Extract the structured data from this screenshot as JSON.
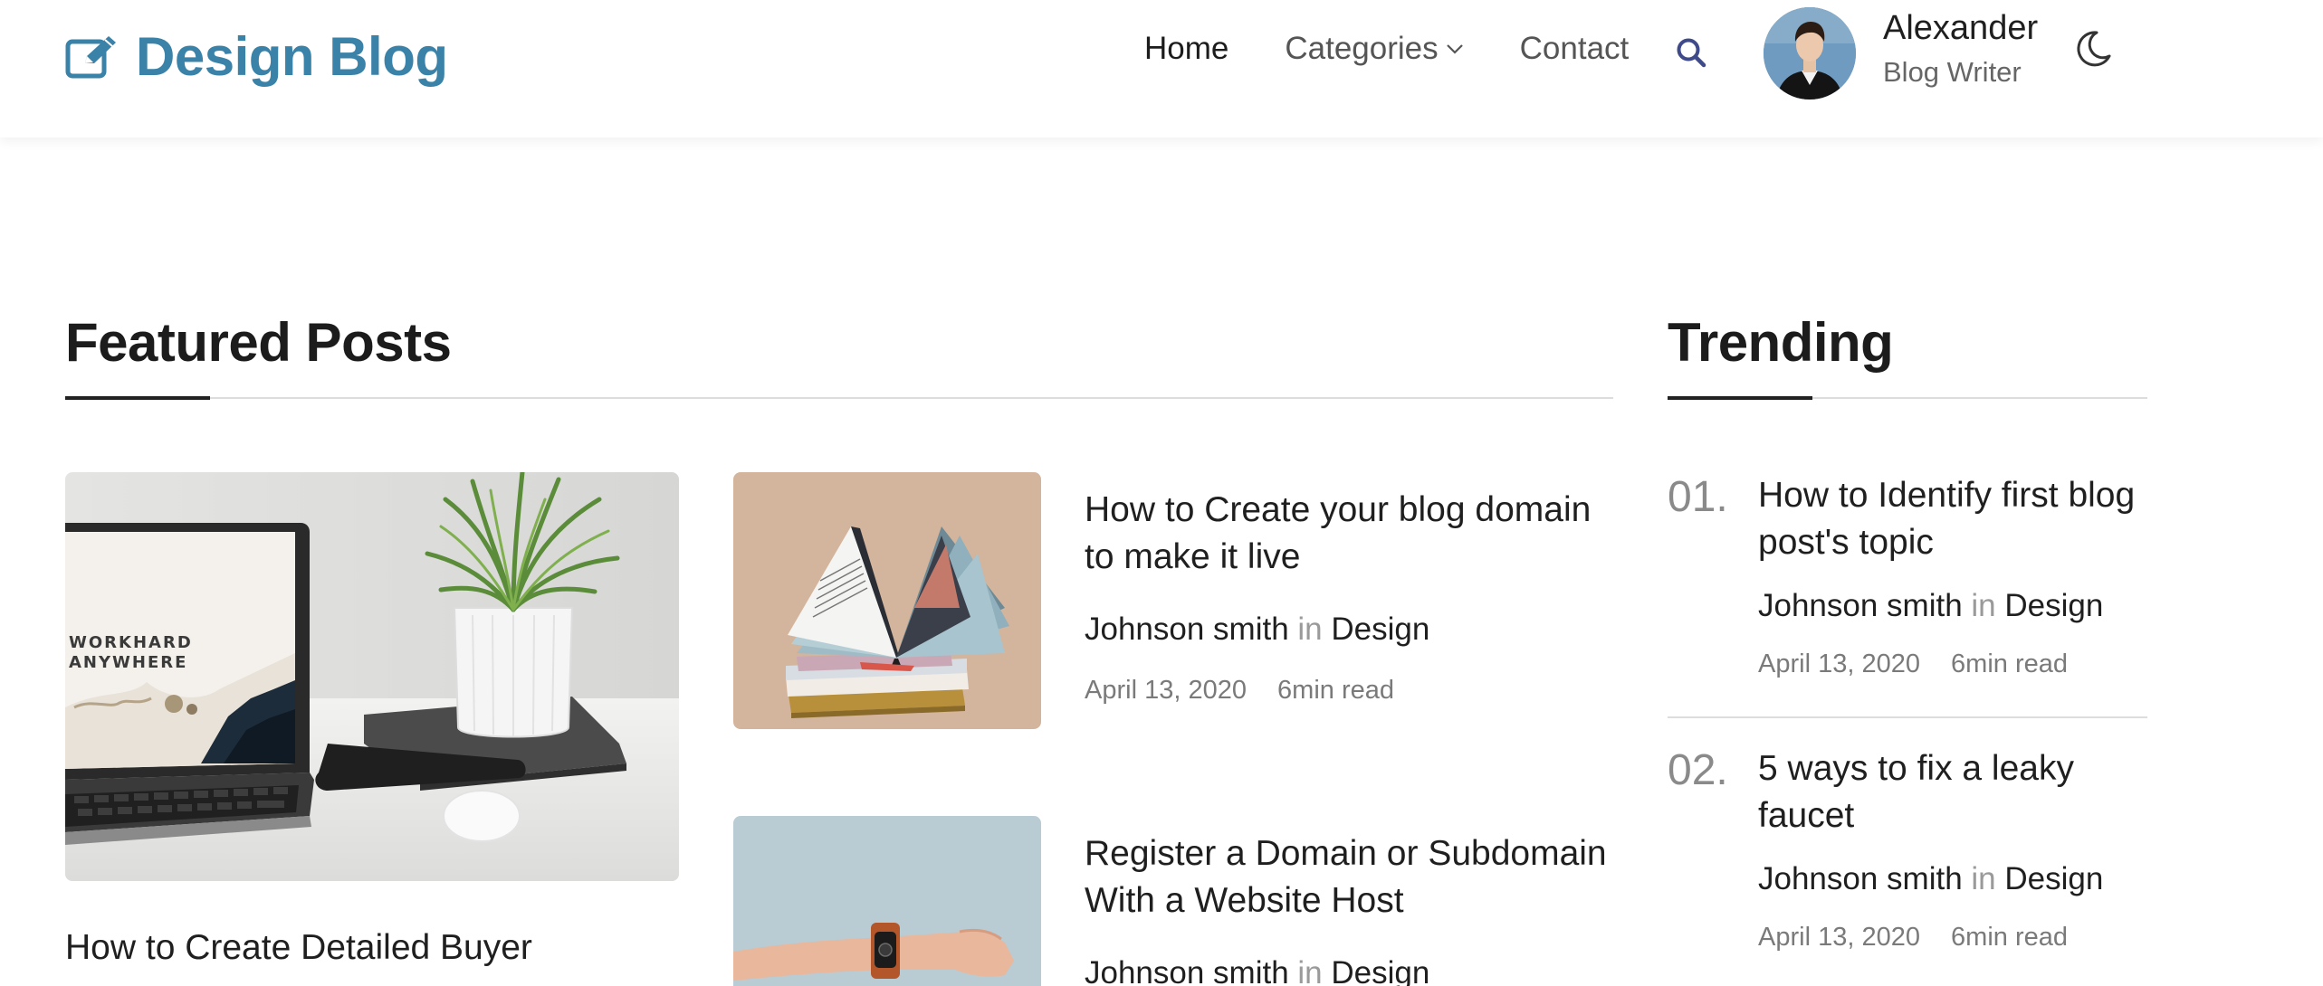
{
  "header": {
    "logo_text": "Design Blog",
    "nav": {
      "home": "Home",
      "categories": "Categories",
      "contact": "Contact"
    },
    "user": {
      "name": "Alexander",
      "role": "Blog Writer"
    }
  },
  "colors": {
    "brand": "#3b82a8",
    "heading": "#1c1c1c",
    "muted": "#7a7a7a"
  },
  "featured": {
    "title": "Featured Posts",
    "main_post": {
      "title": "How to Create Detailed Buyer",
      "screen_text_1": "WORKHARD",
      "screen_text_2": "ANYWHERE"
    },
    "posts": [
      {
        "title_line1": "How to Create your blog domain",
        "title_line2": "to make it live",
        "author": "Johnson smith",
        "in": "in",
        "category": "Design",
        "date": "April 13, 2020",
        "read": "6min read"
      },
      {
        "title_line1": "Register a Domain or Subdomain",
        "title_line2": "With a Website Host",
        "author": "Johnson smith",
        "in": "in",
        "category": "Design"
      }
    ]
  },
  "trending": {
    "title": "Trending",
    "items": [
      {
        "num": "01.",
        "title_line1": "How to Identify first blog",
        "title_line2": "post's topic",
        "author": "Johnson smith",
        "in": "in",
        "category": "Design",
        "date": "April 13, 2020",
        "read": "6min read"
      },
      {
        "num": "02.",
        "title_line1": "5 ways to fix a leaky",
        "title_line2": "faucet",
        "author": "Johnson smith",
        "in": "in",
        "category": "Design",
        "date": "April 13, 2020",
        "read": "6min read"
      }
    ]
  }
}
